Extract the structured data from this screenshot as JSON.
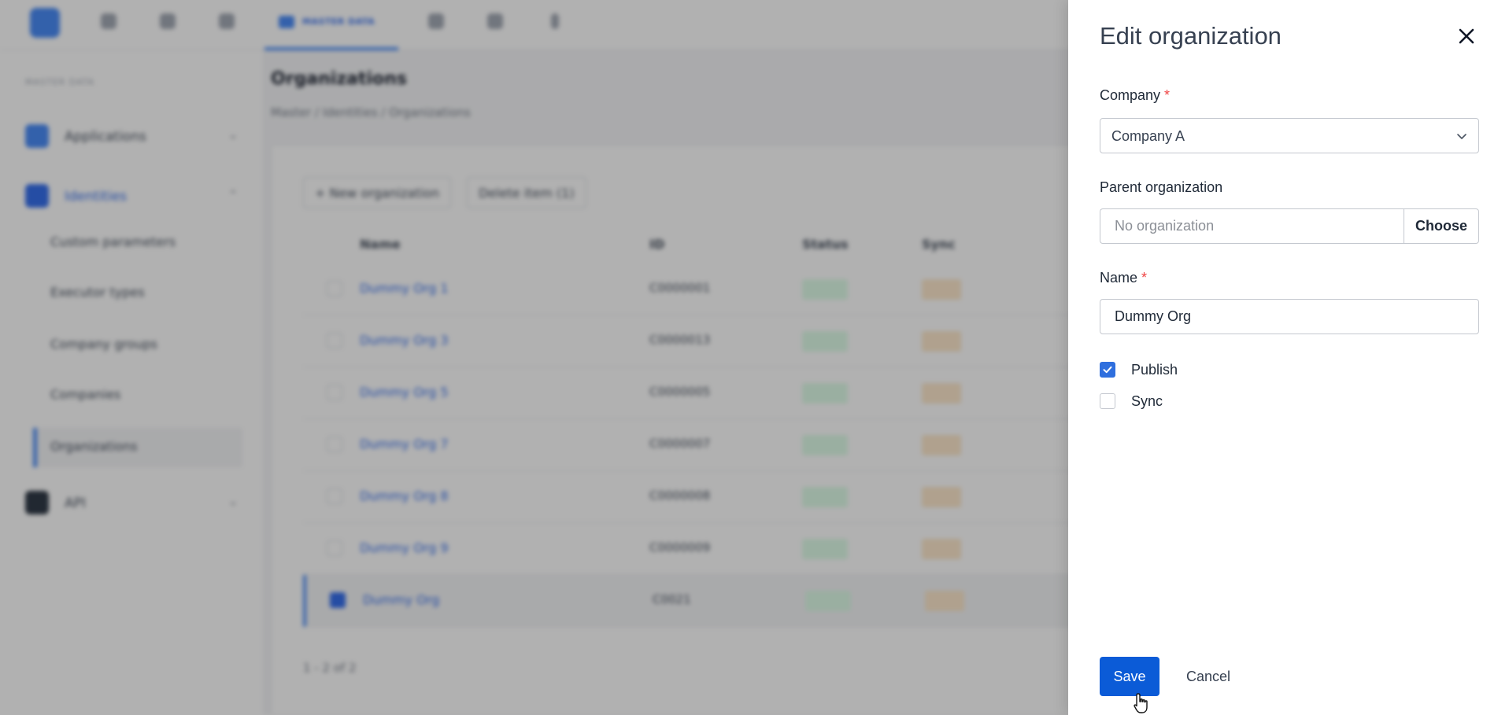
{
  "background": {
    "nav": {
      "active_tab": "MASTER DATA"
    },
    "sidebar": {
      "section": "MASTER DATA",
      "items": [
        {
          "label": "Applications",
          "icon": "applications-icon"
        },
        {
          "label": "Identities",
          "icon": "shield-icon"
        },
        {
          "label": "API",
          "icon": "api-icon"
        }
      ],
      "sub_items": [
        "Custom parameters",
        "Executor types",
        "Company groups",
        "Companies",
        "Organizations"
      ]
    },
    "page": {
      "title": "Organizations",
      "breadcrumb": "Master  /  Identities  /  Organizations",
      "new_button": "+ New organization",
      "delete_button": "Delete item (1)",
      "columns": [
        "Name",
        "ID",
        "Status",
        "Sync"
      ],
      "rows": [
        {
          "name": "Dummy Org 1",
          "id": "C0000001"
        },
        {
          "name": "Dummy Org 3",
          "id": "C0000013"
        },
        {
          "name": "Dummy Org 5",
          "id": "C0000005"
        },
        {
          "name": "Dummy Org 7",
          "id": "C0000007"
        },
        {
          "name": "Dummy Org 8",
          "id": "C0000008"
        },
        {
          "name": "Dummy Org 9",
          "id": "C0000009"
        },
        {
          "name": "Dummy Org",
          "id": "C0021"
        }
      ],
      "pager": "1 - 2 of 2"
    }
  },
  "drawer": {
    "title": "Edit organization",
    "company": {
      "label": "Company",
      "required_mark": "*",
      "value": "Company A"
    },
    "parent": {
      "label": "Parent organization",
      "placeholder": "No organization",
      "choose_label": "Choose"
    },
    "name": {
      "label": "Name",
      "required_mark": "*",
      "value": "Dummy Org"
    },
    "publish": {
      "label": "Publish",
      "checked": true
    },
    "sync": {
      "label": "Sync",
      "checked": false
    },
    "save_label": "Save",
    "cancel_label": "Cancel"
  },
  "colors": {
    "primary": "#0b5bd7",
    "checkbox": "#2f6fde",
    "required": "#ef4444"
  }
}
